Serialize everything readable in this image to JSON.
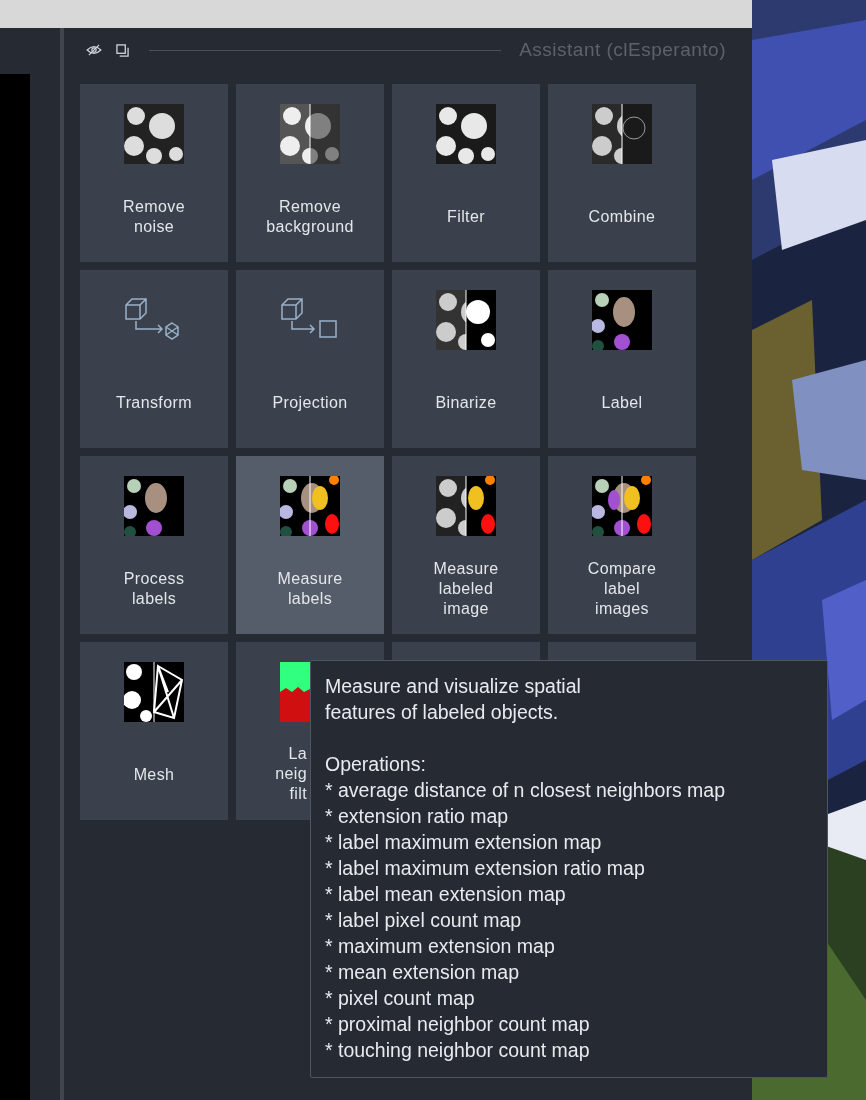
{
  "panel": {
    "title": "Assistant (clEsperanto)"
  },
  "tiles": [
    {
      "label": [
        "Remove",
        "noise"
      ],
      "selected": false
    },
    {
      "label": [
        "Remove",
        "background"
      ],
      "selected": false
    },
    {
      "label": [
        "Filter"
      ],
      "selected": false
    },
    {
      "label": [
        "Combine"
      ],
      "selected": false
    },
    {
      "label": [
        "Transform"
      ],
      "selected": false
    },
    {
      "label": [
        "Projection"
      ],
      "selected": false
    },
    {
      "label": [
        "Binarize"
      ],
      "selected": false
    },
    {
      "label": [
        "Label"
      ],
      "selected": false
    },
    {
      "label": [
        "Process",
        "labels"
      ],
      "selected": false
    },
    {
      "label": [
        "Measure",
        "labels"
      ],
      "selected": true
    },
    {
      "label": [
        "Measure",
        "labeled",
        "image"
      ],
      "selected": false
    },
    {
      "label": [
        "Compare",
        "label",
        "images"
      ],
      "selected": false
    },
    {
      "label": [
        "Mesh"
      ],
      "selected": false
    },
    {
      "label": [
        "La",
        "neig",
        "filt"
      ],
      "selected": false,
      "kind": "covered"
    },
    {
      "kind": "hidden"
    },
    {
      "kind": "hidden"
    }
  ],
  "tooltip": {
    "description": "Measure and visualize spatial features of labeled objects.",
    "heading": "Operations:",
    "items": [
      "* average distance of n closest neighbors map",
      "* extension ratio map",
      "* label maximum extension map",
      "* label maximum extension ratio map",
      "* label mean extension map",
      "* label pixel count map",
      "* maximum extension map",
      "* mean extension map",
      "* pixel count map",
      "* proximal neighbor count map",
      "* touching neighbor count map"
    ]
  }
}
